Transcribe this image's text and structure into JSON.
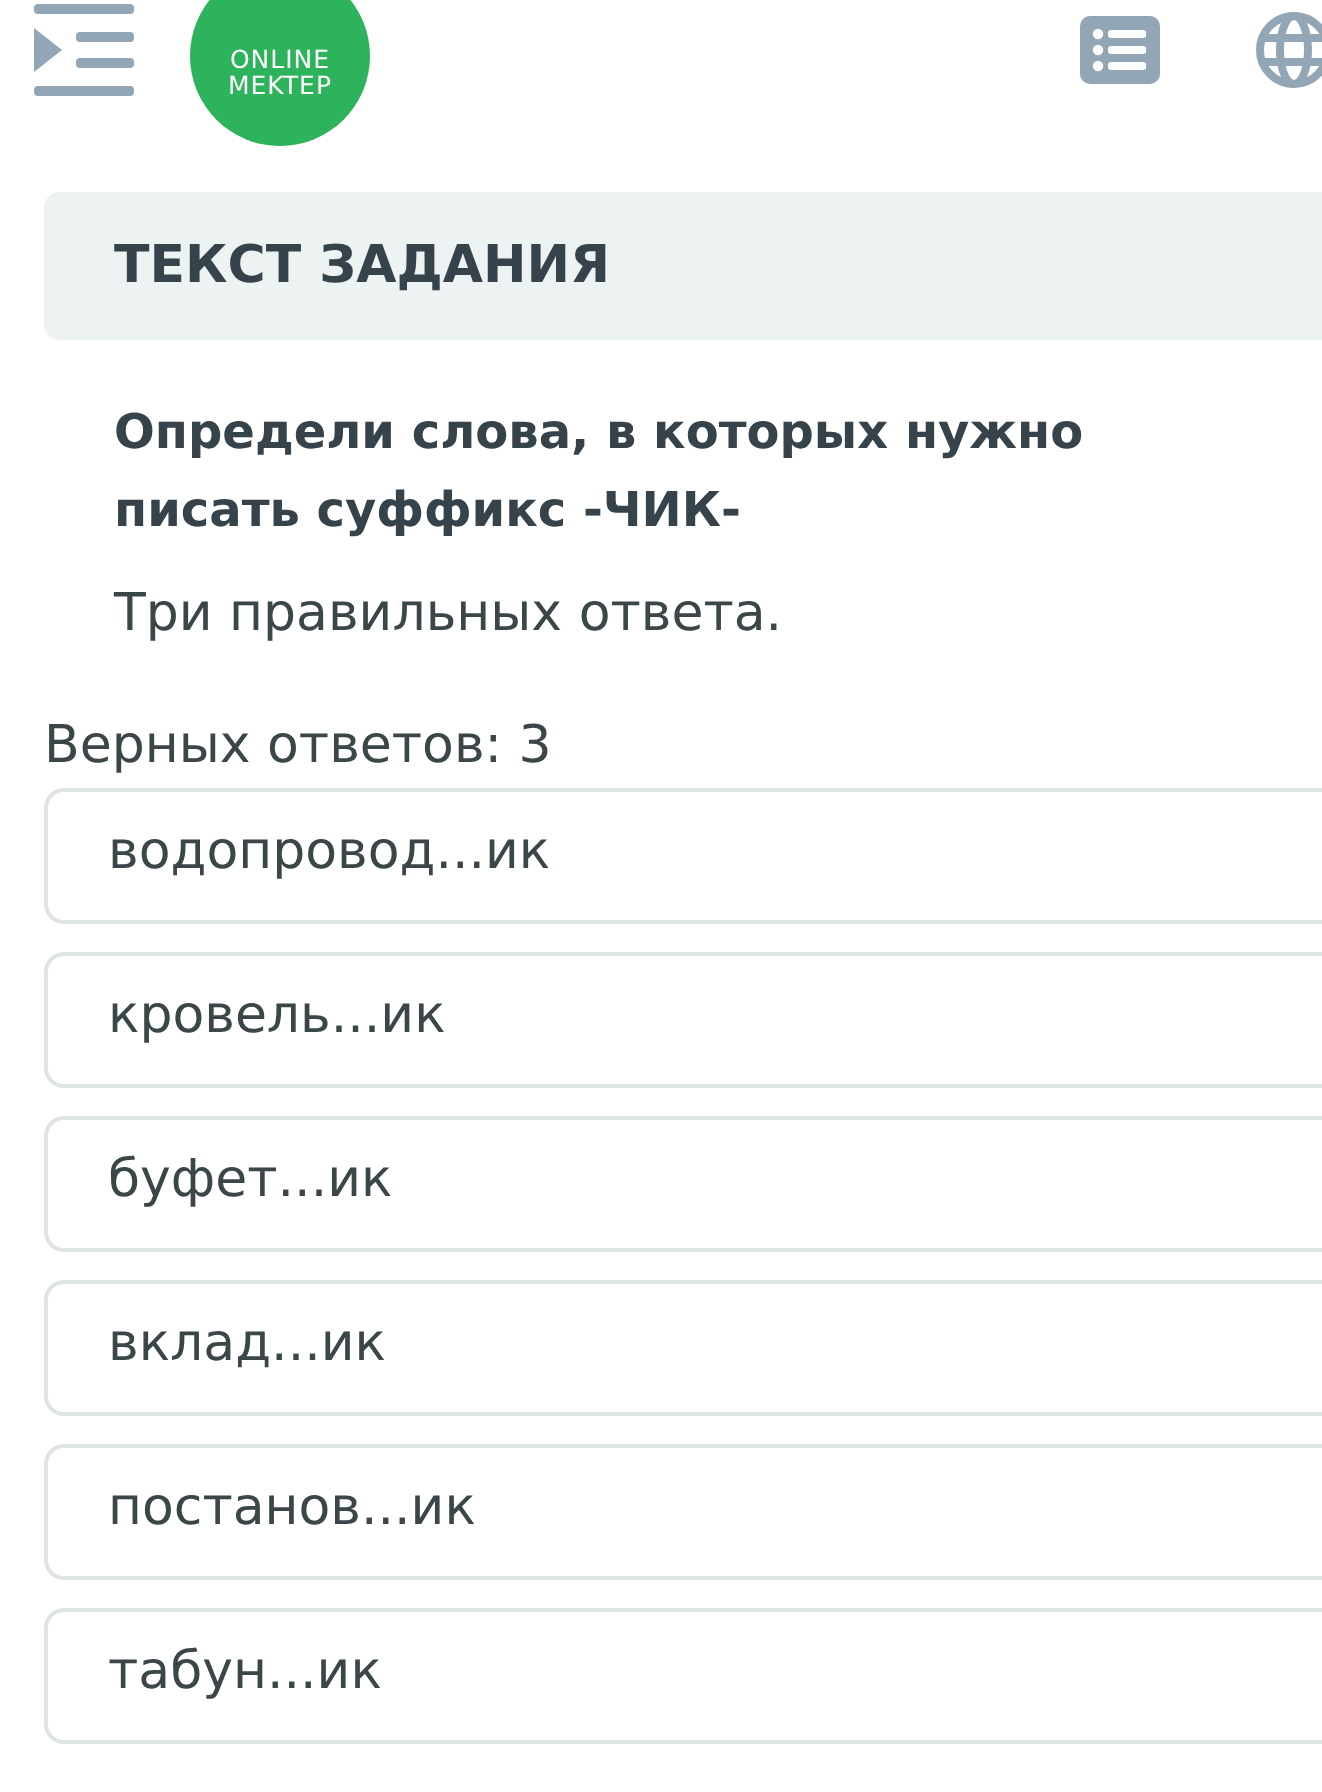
{
  "header": {
    "logo": {
      "lines": [
        "ONLINE",
        "MEKTEP"
      ]
    }
  },
  "task": {
    "heading": "ТЕКСТ ЗАДАНИЯ",
    "question": "Определи слова, в которых нужно писать суффикс -ЧИК-",
    "hint": "Три правильных ответа."
  },
  "answers_info": "Верных ответов: 3",
  "options": [
    {
      "text": "водопровод...ик",
      "selected": false
    },
    {
      "text": "кровель...ик",
      "selected": false
    },
    {
      "text": "буфет...ик",
      "selected": false
    },
    {
      "text": "вклад...ик",
      "selected": false
    },
    {
      "text": "постанов...ик",
      "selected": false
    },
    {
      "text": "табун...ик",
      "selected": false
    }
  ]
}
